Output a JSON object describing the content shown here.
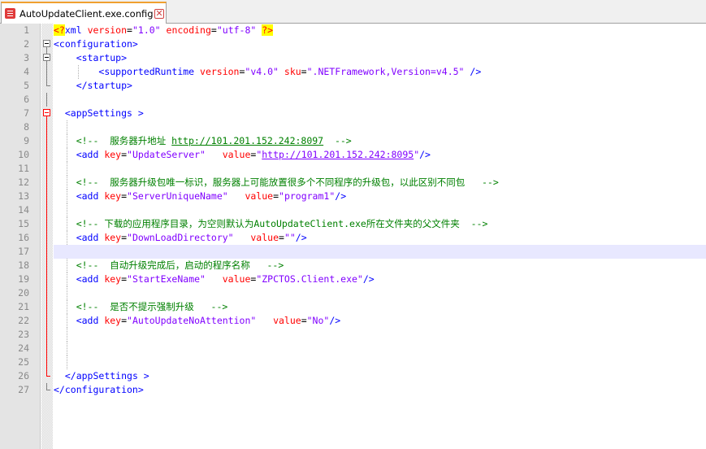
{
  "tab": {
    "label": "AutoUpdateClient.exe.config",
    "close": "✕"
  },
  "colors": {
    "tag": "#0000ff",
    "attribute": "#ff0000",
    "value": "#8000ff",
    "comment": "#008000",
    "current_line": "#e8e8ff",
    "fold_marker": "#ff0000"
  },
  "lines": [
    {
      "n": "1",
      "fold": "none",
      "indent": 0,
      "guides": [],
      "tokens": [
        {
          "t": "decl",
          "v": "<?"
        },
        {
          "t": "tag",
          "v": "xml "
        },
        {
          "t": "attr",
          "v": "version"
        },
        {
          "t": "plain",
          "v": "="
        },
        {
          "t": "val",
          "v": "\"1.0\" "
        },
        {
          "t": "attr",
          "v": "encoding"
        },
        {
          "t": "plain",
          "v": "="
        },
        {
          "t": "val",
          "v": "\"utf-8\" "
        },
        {
          "t": "decl",
          "v": "?>"
        }
      ]
    },
    {
      "n": "2",
      "fold": "open",
      "indent": 0,
      "guides": [],
      "tokens": [
        {
          "t": "tag",
          "v": "<configuration>"
        }
      ]
    },
    {
      "n": "3",
      "fold": "open-inner",
      "indent": 4,
      "guides": [],
      "tokens": [
        {
          "t": "tag",
          "v": "<startup>"
        }
      ]
    },
    {
      "n": "4",
      "fold": "line",
      "indent": 8,
      "guides": [
        4
      ],
      "tokens": [
        {
          "t": "tag",
          "v": "<supportedRuntime "
        },
        {
          "t": "attr",
          "v": "version"
        },
        {
          "t": "plain",
          "v": "="
        },
        {
          "t": "val",
          "v": "\"v4.0\" "
        },
        {
          "t": "attr",
          "v": "sku"
        },
        {
          "t": "plain",
          "v": "="
        },
        {
          "t": "val",
          "v": "\".NETFramework,Version=v4.5\" "
        },
        {
          "t": "tag",
          "v": "/>"
        }
      ]
    },
    {
      "n": "5",
      "fold": "end",
      "indent": 4,
      "guides": [],
      "tokens": [
        {
          "t": "tag",
          "v": "</startup>"
        }
      ]
    },
    {
      "n": "6",
      "fold": "line",
      "indent": 0,
      "guides": [],
      "tokens": []
    },
    {
      "n": "7",
      "fold": "open-red",
      "indent": 2,
      "guides": [],
      "tokens": [
        {
          "t": "tag",
          "v": "<appSettings >"
        }
      ]
    },
    {
      "n": "8",
      "fold": "line-red",
      "indent": 0,
      "guides": [
        2
      ],
      "tokens": []
    },
    {
      "n": "9",
      "fold": "line-red",
      "indent": 4,
      "guides": [
        2
      ],
      "tokens": [
        {
          "t": "cmt",
          "v": "<!--  服务器升地址 "
        },
        {
          "t": "cmt-url",
          "v": "http://101.201.152.242:8097"
        },
        {
          "t": "cmt",
          "v": "  -->"
        }
      ]
    },
    {
      "n": "10",
      "fold": "line-red",
      "indent": 4,
      "guides": [
        2
      ],
      "tokens": [
        {
          "t": "tag",
          "v": "<add "
        },
        {
          "t": "attr",
          "v": "key"
        },
        {
          "t": "plain",
          "v": "="
        },
        {
          "t": "val",
          "v": "\"UpdateServer\"   "
        },
        {
          "t": "attr",
          "v": "value"
        },
        {
          "t": "plain",
          "v": "="
        },
        {
          "t": "val",
          "v": "\""
        },
        {
          "t": "url",
          "v": "http://101.201.152.242:8095"
        },
        {
          "t": "val",
          "v": "\""
        },
        {
          "t": "tag",
          "v": "/>"
        }
      ]
    },
    {
      "n": "11",
      "fold": "line-red",
      "indent": 0,
      "guides": [
        2
      ],
      "tokens": []
    },
    {
      "n": "12",
      "fold": "line-red",
      "indent": 4,
      "guides": [
        2
      ],
      "tokens": [
        {
          "t": "cmt",
          "v": "<!--  服务器升级包唯一标识，服务器上可能放置很多个不同程序的升级包，以此区别不同包   -->"
        }
      ]
    },
    {
      "n": "13",
      "fold": "line-red",
      "indent": 4,
      "guides": [
        2
      ],
      "tokens": [
        {
          "t": "tag",
          "v": "<add "
        },
        {
          "t": "attr",
          "v": "key"
        },
        {
          "t": "plain",
          "v": "="
        },
        {
          "t": "val",
          "v": "\"ServerUniqueName\"   "
        },
        {
          "t": "attr",
          "v": "value"
        },
        {
          "t": "plain",
          "v": "="
        },
        {
          "t": "val",
          "v": "\"program1\""
        },
        {
          "t": "tag",
          "v": "/>"
        }
      ]
    },
    {
      "n": "14",
      "fold": "line-red",
      "indent": 0,
      "guides": [
        2
      ],
      "tokens": []
    },
    {
      "n": "15",
      "fold": "line-red",
      "indent": 4,
      "guides": [
        2
      ],
      "tokens": [
        {
          "t": "cmt",
          "v": "<!-- 下载的应用程序目录，为空则默认为AutoUpdateClient.exe所在文件夹的父文件夹  -->"
        }
      ]
    },
    {
      "n": "16",
      "fold": "line-red",
      "indent": 4,
      "guides": [
        2
      ],
      "tokens": [
        {
          "t": "tag",
          "v": "<add "
        },
        {
          "t": "attr",
          "v": "key"
        },
        {
          "t": "plain",
          "v": "="
        },
        {
          "t": "val",
          "v": "\"DownLoadDirectory\"   "
        },
        {
          "t": "attr",
          "v": "value"
        },
        {
          "t": "plain",
          "v": "="
        },
        {
          "t": "val",
          "v": "\"\""
        },
        {
          "t": "tag",
          "v": "/>"
        }
      ]
    },
    {
      "n": "17",
      "fold": "line-red",
      "indent": 0,
      "guides": [],
      "current": true,
      "tokens": []
    },
    {
      "n": "18",
      "fold": "line-red",
      "indent": 4,
      "guides": [
        2
      ],
      "tokens": [
        {
          "t": "cmt",
          "v": "<!--  自动升级完成后，启动的程序名称   -->"
        }
      ]
    },
    {
      "n": "19",
      "fold": "line-red",
      "indent": 4,
      "guides": [
        2
      ],
      "tokens": [
        {
          "t": "tag",
          "v": "<add "
        },
        {
          "t": "attr",
          "v": "key"
        },
        {
          "t": "plain",
          "v": "="
        },
        {
          "t": "val",
          "v": "\"StartExeName\"   "
        },
        {
          "t": "attr",
          "v": "value"
        },
        {
          "t": "plain",
          "v": "="
        },
        {
          "t": "val",
          "v": "\"ZPCTOS.Client.exe\""
        },
        {
          "t": "tag",
          "v": "/>"
        }
      ]
    },
    {
      "n": "20",
      "fold": "line-red",
      "indent": 0,
      "guides": [
        2
      ],
      "tokens": []
    },
    {
      "n": "21",
      "fold": "line-red",
      "indent": 4,
      "guides": [
        2
      ],
      "tokens": [
        {
          "t": "cmt",
          "v": "<!--  是否不提示强制升级   -->"
        }
      ]
    },
    {
      "n": "22",
      "fold": "line-red",
      "indent": 4,
      "guides": [
        2
      ],
      "tokens": [
        {
          "t": "tag",
          "v": "<add "
        },
        {
          "t": "attr",
          "v": "key"
        },
        {
          "t": "plain",
          "v": "="
        },
        {
          "t": "val",
          "v": "\"AutoUpdateNoAttention\"   "
        },
        {
          "t": "attr",
          "v": "value"
        },
        {
          "t": "plain",
          "v": "="
        },
        {
          "t": "val",
          "v": "\"No\""
        },
        {
          "t": "tag",
          "v": "/>"
        }
      ]
    },
    {
      "n": "23",
      "fold": "line-red",
      "indent": 0,
      "guides": [
        2
      ],
      "tokens": []
    },
    {
      "n": "24",
      "fold": "line-red",
      "indent": 0,
      "guides": [
        2
      ],
      "tokens": []
    },
    {
      "n": "25",
      "fold": "line-red",
      "indent": 0,
      "guides": [
        2
      ],
      "tokens": []
    },
    {
      "n": "26",
      "fold": "end-red",
      "indent": 2,
      "guides": [],
      "tokens": [
        {
          "t": "tag",
          "v": "</appSettings >"
        }
      ]
    },
    {
      "n": "27",
      "fold": "end",
      "indent": 0,
      "guides": [],
      "tokens": [
        {
          "t": "tag",
          "v": "</configuration>"
        }
      ]
    }
  ]
}
